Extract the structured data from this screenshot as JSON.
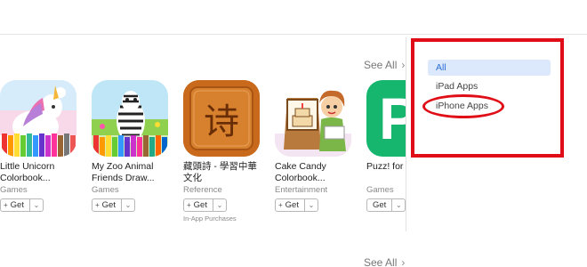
{
  "section1": {
    "see_all": "See All"
  },
  "section2": {
    "see_all": "See All"
  },
  "apps": [
    {
      "name": "Little Unicorn Colorbook...",
      "category": "Games",
      "get": "Get",
      "note": ""
    },
    {
      "name": "My Zoo Animal Friends Draw...",
      "category": "Games",
      "get": "Get",
      "note": ""
    },
    {
      "name": "藏頭詩 - 學習中華文化",
      "category": "Reference",
      "get": "Get",
      "note": "In-App Purchases",
      "glyph": "诗"
    },
    {
      "name": "Cake Candy Colorbook...",
      "category": "Entertainment",
      "get": "Get",
      "note": ""
    },
    {
      "name": "Puzz! for Instagram",
      "category": "Games",
      "get": "Get",
      "note": "",
      "glyph": "P"
    }
  ],
  "dropdown": {
    "items": [
      "All",
      "iPad Apps",
      "iPhone Apps"
    ],
    "selected": "All"
  },
  "colors": {
    "highlight": "#e00d16",
    "selected_bg": "#dce9fc",
    "selected_text": "#2b6fd6"
  }
}
